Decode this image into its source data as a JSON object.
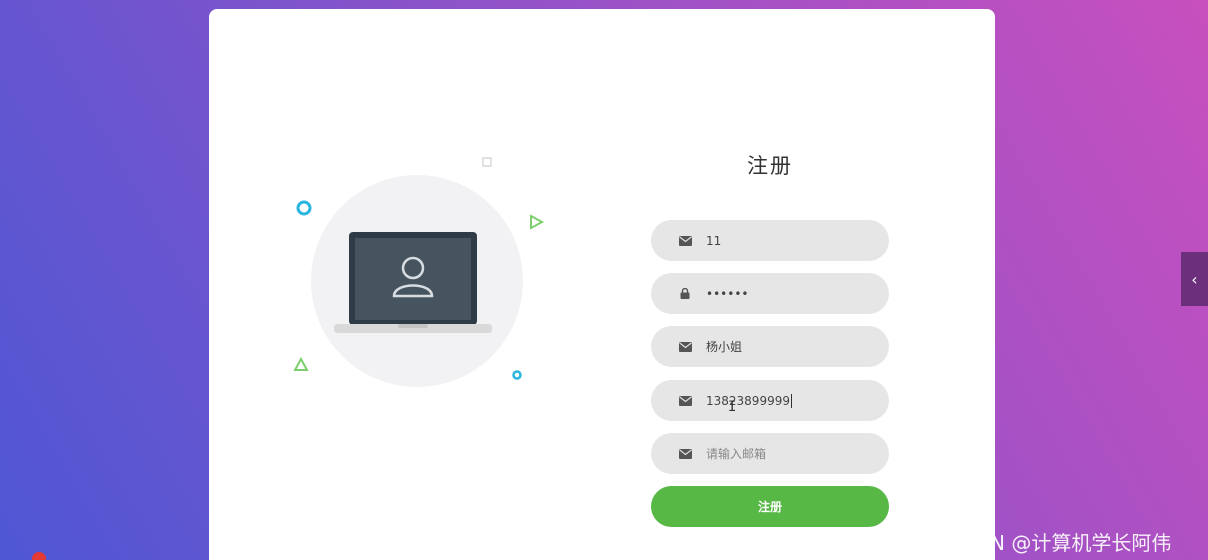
{
  "form": {
    "title": "注册",
    "fields": [
      {
        "icon": "envelope-icon",
        "value": "11"
      },
      {
        "icon": "lock-icon",
        "value": "••••••"
      },
      {
        "icon": "envelope-icon",
        "value": "杨小姐"
      },
      {
        "icon": "envelope-icon",
        "value": "13823899999"
      },
      {
        "icon": "envelope-icon",
        "placeholder": "请输入邮箱",
        "value": ""
      }
    ],
    "submit_label": "注册"
  },
  "side_tab": {
    "icon": "chevron-left-icon",
    "glyph": "‹"
  },
  "watermark": "CSDN @计算机学长阿伟",
  "colors": {
    "accent": "#57b846",
    "field_bg": "#e6e6e6",
    "side_tab": "#6b2f7c"
  }
}
